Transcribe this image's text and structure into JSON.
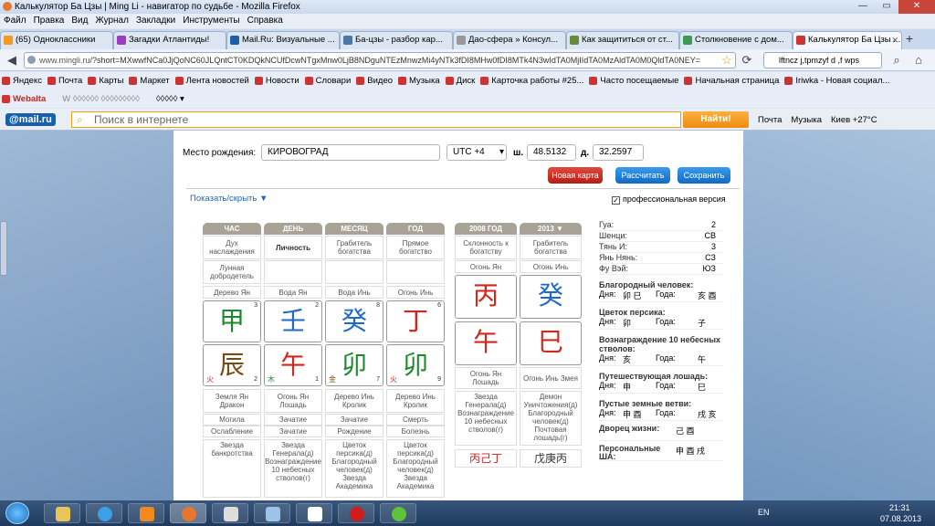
{
  "window": {
    "title": "Калькулятор Ба Цзы | Ming Li - навигатор по судьбе - Mozilla Firefox"
  },
  "menu": [
    "Файл",
    "Правка",
    "Вид",
    "Журнал",
    "Закладки",
    "Инструменты",
    "Справка"
  ],
  "tabs": [
    {
      "label": "(65) Одноклассники",
      "color": "#f39a1e"
    },
    {
      "label": "Загадки Атлантиды!",
      "color": "#9b3cc1"
    },
    {
      "label": "Mail.Ru: Визуальные ...",
      "color": "#1a5fa8"
    },
    {
      "label": "Ба-цзы - разбор кар...",
      "color": "#4a76a8"
    },
    {
      "label": "Дао-сфера » Консул...",
      "color": "#999999"
    },
    {
      "label": "Как защититься от ст...",
      "color": "#6a8a3a"
    },
    {
      "label": "Столкновение с дом...",
      "color": "#3b9b52"
    },
    {
      "label": "Калькулятор Ба Цзы ...",
      "color": "#cc3333"
    }
  ],
  "nav": {
    "url_host": "www.mingli.ru",
    "url_rest": "/?short=MXwwfNCa0JjQoNC60JLQntCT0KDQkNCUfDcwNTgxMnw0LjB8NDguNTEzMnwzMi4yNTk3fDI8MHw0fDI8MTk4N3wIdTA0MjIIdTA0MzAldTA0M0QldTA0NEY=",
    "search": "lftncz j,tpmzyf d ,f wps"
  },
  "bookmarks": [
    "Яндекс",
    "Почта",
    "Карты",
    "Маркет",
    "Лента новостей",
    "Новости",
    "Словари",
    "Видео",
    "Музыка",
    "Диск",
    "Карточка работы #25...",
    "Часто посещаемые",
    "Начальная страница",
    "Iriwka - Новая социал..."
  ],
  "addons": [
    "Webalta",
    "W ◊◊◊◊◊◊ ◊◊◊◊◊◊◊◊◊",
    "◊◊◊◊◊ ▾"
  ],
  "mailru": {
    "logo": "@mail.ru",
    "search_placeholder": "Поиск в интернете",
    "find": "Найти!",
    "links": [
      "Почта",
      "Музыка",
      "Киев +27°C"
    ]
  },
  "form": {
    "birthplace_label": "Место рождения:",
    "birthplace": "КИРОВОГРАД",
    "utc": "UTC +4",
    "lat_label": "ш.",
    "lat": "48.5132",
    "lon_label": "д.",
    "lon": "32.2597",
    "new_card": "Новая карта",
    "calc": "Рассчитать",
    "save": "Сохранить",
    "showhide": "Показать/скрыть ▼",
    "pro": "профессиональная версия"
  },
  "pillars": {
    "headers": [
      "ЧАС",
      "ДЕНЬ",
      "МЕСЯЦ",
      "ГОД"
    ],
    "spirit": [
      "Дух наслаждения",
      "Личность",
      "Грабитель богатства",
      "Прямое богатство"
    ],
    "star2": [
      "Лунная добродетель",
      "",
      "",
      ""
    ],
    "stem_names": [
      "Дерево Ян",
      "Вода Ян",
      "Вода Инь",
      "Огонь Инь"
    ],
    "stems": [
      {
        "ch": "甲",
        "n": "3"
      },
      {
        "ch": "壬",
        "n": "2"
      },
      {
        "ch": "癸",
        "n": "8"
      },
      {
        "ch": "丁",
        "n": "6"
      }
    ],
    "branches": [
      {
        "ch": "辰",
        "n": "2",
        "el": "火"
      },
      {
        "ch": "午",
        "n": "1",
        "el": "木"
      },
      {
        "ch": "卯",
        "n": "7",
        "el": "金"
      },
      {
        "ch": "卯",
        "n": "9",
        "el": "火"
      }
    ],
    "branch_names": [
      "Земля Ян Дракон",
      "Огонь Ян Лошадь",
      "Дерево Инь Кролик",
      "Дерево Инь Кролик"
    ],
    "stage1": [
      "Могила",
      "Зачатие",
      "Зачатие",
      "Смерть"
    ],
    "stage2": [
      "Ослабление",
      "Зачатие",
      "Рождение",
      "Болезнь"
    ],
    "symbolic": [
      "Звезда банкротства",
      "Звезда Генерала(д) Вознаграждение 10 небесных стволов(г)",
      "Цветок персика(д) Благородный человек(д) Звезда Академика",
      "Цветок персика(д) Благородный человек(д) Звезда Академика"
    ]
  },
  "luck": {
    "headers": [
      "2008 ГОД",
      "2013 ▼"
    ],
    "spirit": [
      "Склонность к богатству",
      "Грабитель богатства"
    ],
    "stem_names": [
      "Огонь Ян",
      "Огонь Инь"
    ],
    "stems": [
      "丙",
      "癸"
    ],
    "branches": [
      "午",
      "巳"
    ],
    "branch_names": [
      "Огонь Ян Лошадь",
      "Огонь Инь Змея"
    ],
    "symbolic": [
      "Звезда Генерала(д) Вознаграждение 10 небесных стволов(г)",
      "Демон Уничтожения(д) Благородный человек(д) Почтовая лошадь(г)"
    ],
    "hidden": [
      "丙己丁",
      "戊庚丙"
    ]
  },
  "info": {
    "rows": [
      [
        "Гуа:",
        "2"
      ],
      [
        "Шенци:",
        "СВ"
      ],
      [
        "Тянь И:",
        "3"
      ],
      [
        "Янь Нянь:",
        "СЗ"
      ],
      [
        "Фу Вэй:",
        "ЮЗ"
      ]
    ],
    "noble_title": "Благородный человек:",
    "noble_day": "卯 巳",
    "noble_year": "亥 酉",
    "peach_title": "Цветок персика:",
    "peach_day": "卯",
    "peach_year": "子",
    "reward_title": "Вознаграждение 10 небесных стволов:",
    "reward_day": "亥",
    "reward_year": "午",
    "horse_title": "Путешествующая лошадь:",
    "horse_day": "申",
    "horse_year": "巳",
    "empty_title": "Пустые земные ветви:",
    "empty_day": "申 酉",
    "empty_year": "戌 亥",
    "palace_title": "Дворец жизни:",
    "palace": "己 酉",
    "sha_title": "Персональные ША:",
    "sha": "申 酉 戌",
    "day_label": "Дня:",
    "year_label": "Года:"
  },
  "tray": {
    "lang": "EN",
    "time": "21:31",
    "date": "07.08.2013"
  }
}
